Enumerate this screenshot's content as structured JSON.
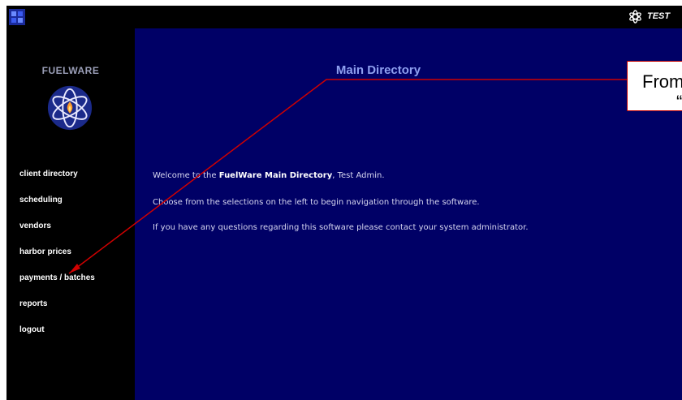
{
  "header": {
    "corner_icon": "app-icon",
    "test_label": "TEST",
    "test_icon": "atom-logo-icon"
  },
  "sidebar": {
    "brand": "FUELWARE",
    "brand_icon": "atom-flame-logo-icon",
    "items": [
      {
        "label": "client directory"
      },
      {
        "label": "scheduling"
      },
      {
        "label": "vendors"
      },
      {
        "label": "harbor prices"
      },
      {
        "label": "payments / batches"
      },
      {
        "label": "reports"
      },
      {
        "label": "logout"
      }
    ]
  },
  "main": {
    "title": "Main Directory",
    "welcome_prefix": "Welcome to the ",
    "welcome_bold": "FuelWare Main Directory",
    "welcome_suffix": ", Test Admin.",
    "instructions": "Choose from the selections on the left to begin navigation through the software.",
    "contact": "If you have any questions regarding this software please contact your system administrator."
  },
  "callout": {
    "line1": "From",
    "line2": "“"
  },
  "colors": {
    "sidebar_bg": "#000000",
    "main_bg": "#000066",
    "title": "#8fa0f0",
    "callout_border": "#c00000",
    "arrow": "#d00000"
  }
}
